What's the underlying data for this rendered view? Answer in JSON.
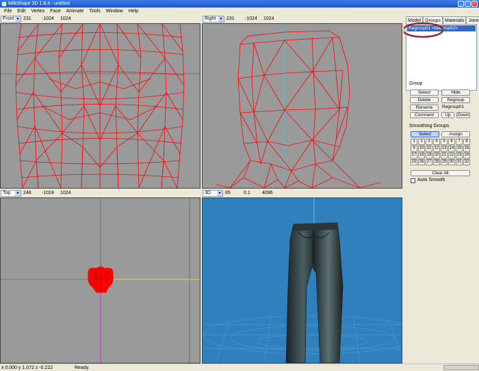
{
  "window": {
    "title": "MilkShape 3D 1.8.4 - untitled",
    "min": "_",
    "max": "□",
    "close": "x"
  },
  "menu": [
    "File",
    "Edit",
    "Vertex",
    "Face",
    "Animate",
    "Tools",
    "Window",
    "Help"
  ],
  "viewports": {
    "front": {
      "view": "Front",
      "v1": "231",
      "v2": "-1024",
      "v3": "1024"
    },
    "right": {
      "view": "Right",
      "v1": "231",
      "v2": "-1024",
      "v3": "1024"
    },
    "top": {
      "view": "Top",
      "v1": "248",
      "v2": "-1024",
      "v3": "1024"
    },
    "persp": {
      "view": "3D",
      "v1": "65",
      "v2": "0.1",
      "v3": "4096"
    }
  },
  "panel": {
    "tabs": [
      "Model",
      "Groups",
      "Materials",
      "Joints"
    ],
    "group_item": "Regroup01 <Material02>",
    "group_label": "Group",
    "select": "Select",
    "hide": "Hide",
    "delete": "Delete",
    "regroup": "Regroup",
    "rename": "Rename",
    "name_value": "Regroup01",
    "comment": "Comment",
    "up": "Up",
    "down": "Down",
    "smoothing_label": "Smoothing Groups",
    "sg_select": "Select",
    "sg_assign": "Assign",
    "sg_numbers": [
      "1",
      "2",
      "3",
      "4",
      "5",
      "6",
      "7",
      "8",
      "9",
      "10",
      "11",
      "12",
      "13",
      "14",
      "15",
      "16",
      "17",
      "18",
      "19",
      "20",
      "21",
      "22",
      "23",
      "24",
      "25",
      "26",
      "27",
      "28",
      "29",
      "30",
      "31",
      "32"
    ],
    "clear_all": "Clear All",
    "auto_smooth": "Auto Smooth"
  },
  "status": {
    "coords": "x 0.000 y 1.072 z -0.222",
    "text": "Ready."
  },
  "colors": {
    "wire": "#ff0000",
    "viewport_bg": "#9a9a9a",
    "persp_bg": "#2f80bd",
    "highlight_circle": "#8b2a2a"
  }
}
